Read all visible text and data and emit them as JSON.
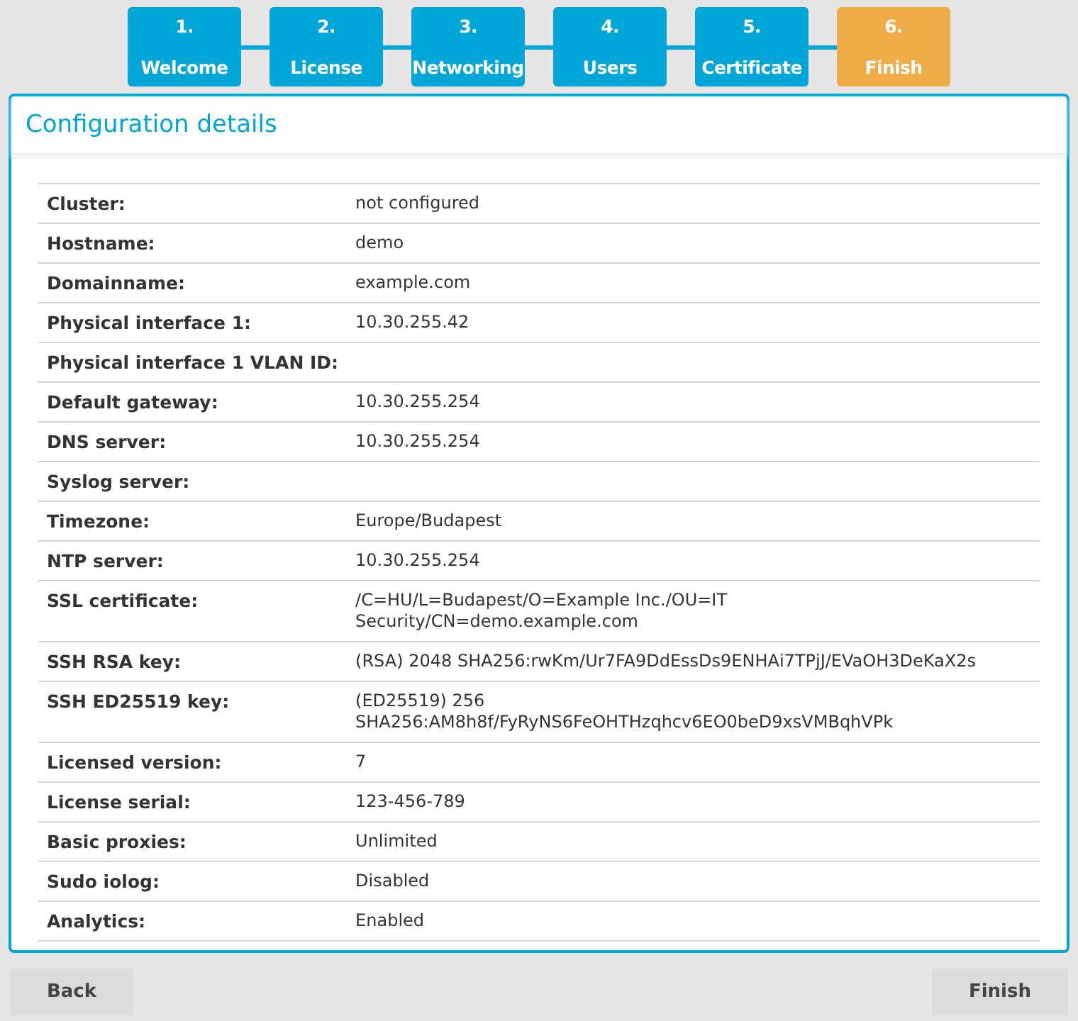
{
  "steps": [
    {
      "number": "1.",
      "label": "Welcome",
      "selected": false
    },
    {
      "number": "2.",
      "label": "License",
      "selected": false
    },
    {
      "number": "3.",
      "label": "Networking",
      "selected": false
    },
    {
      "number": "4.",
      "label": "Users",
      "selected": false
    },
    {
      "number": "5.",
      "label": "Certificate",
      "selected": false
    },
    {
      "number": "6.",
      "label": "Finish",
      "selected": true
    }
  ],
  "panel": {
    "title": "Configuration details",
    "rows": [
      {
        "label": "Cluster:",
        "value": "not configured"
      },
      {
        "label": "Hostname:",
        "value": "demo"
      },
      {
        "label": "Domainname:",
        "value": "example.com"
      },
      {
        "label": "Physical interface 1:",
        "value": "10.30.255.42"
      },
      {
        "label": "Physical interface 1 VLAN ID:"
      },
      {
        "label": "Default gateway:",
        "value": "10.30.255.254"
      },
      {
        "label": "DNS server:",
        "value": "10.30.255.254"
      },
      {
        "label": "Syslog server:"
      },
      {
        "label": "Timezone:",
        "value": "Europe/Budapest"
      },
      {
        "label": "NTP server:",
        "value": "10.30.255.254"
      },
      {
        "label": "SSL certificate:",
        "value": "/C=HU/L=Budapest/O=Example Inc./OU=IT Security/CN=demo.example.com"
      },
      {
        "label": "SSH RSA key:",
        "value": "(RSA) 2048 SHA256:rwKm/Ur7FA9DdEssDs9ENHAi7TPjJ/EVaOH3DeKaX2s"
      },
      {
        "label": "SSH ED25519 key:",
        "value": "(ED25519) 256 SHA256:AM8h8f/FyRyNS6FeOHTHzqhcv6EO0beD9xsVMBqhVPk"
      },
      {
        "label": "Licensed version:",
        "value": "7"
      },
      {
        "label": "License serial:",
        "value": "123-456-789"
      },
      {
        "label": "Basic proxies:",
        "value": "Unlimited"
      },
      {
        "label": "Sudo iolog:",
        "value": "Disabled"
      },
      {
        "label": "Analytics:",
        "value": "Enabled"
      }
    ]
  },
  "buttons": {
    "back": "Back",
    "finish": "Finish"
  }
}
